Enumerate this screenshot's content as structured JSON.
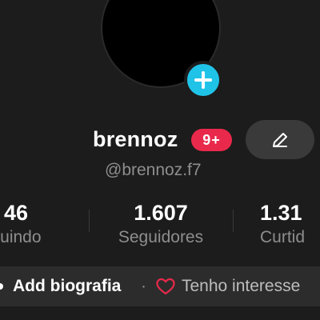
{
  "profile": {
    "username": "brennoz",
    "handle": "@brennoz.f7",
    "notification_badge": "9+"
  },
  "stats": [
    {
      "value": "46",
      "label": "Seguindo"
    },
    {
      "value": "1.607",
      "label": "Seguidores"
    },
    {
      "value": "1.31",
      "label": "Curtidas"
    }
  ],
  "visible_stats": {
    "left_value": "46",
    "left_label": "guindo",
    "mid_value": "1.607",
    "mid_label": "Seguidores",
    "right_value": "1.31",
    "right_label": "Curtid"
  },
  "bio_bar": {
    "add_bio_label": "Add biografia",
    "separator": "·",
    "interests_label": "Tenho interesse"
  },
  "icons": {
    "add_avatar": "plus-icon",
    "edit": "pencil-icon",
    "interests": "heart-icon"
  },
  "colors": {
    "background": "#1c1c1c",
    "badge": "#e9294b",
    "add_button": "#20c3e8",
    "muted_text": "#8e8e8e"
  }
}
